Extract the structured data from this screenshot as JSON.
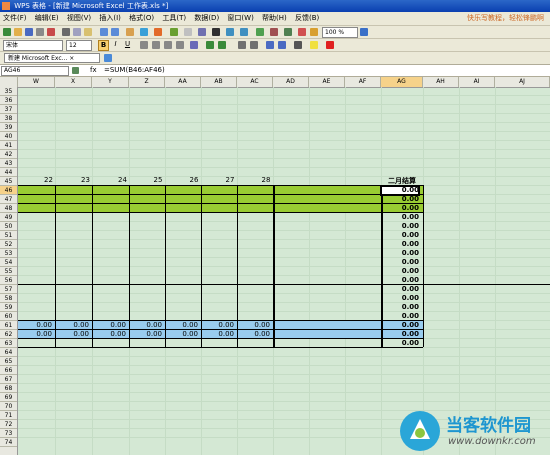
{
  "window": {
    "title": "WPS 表格 - [新建 Microsoft Excel 工作表.xls *]",
    "hint": "快乐写教程，轻松锋鹏啊"
  },
  "menu": {
    "items": [
      "文件(F)",
      "编辑(E)",
      "视图(V)",
      "插入(I)",
      "格式(O)",
      "工具(T)",
      "数据(D)",
      "窗口(W)",
      "帮助(H)",
      "反馈(B)"
    ],
    "hint": "快乐写教程，轻松锋鹏啊"
  },
  "toolbar": {
    "zoom": "100 %",
    "font_name": "宋体",
    "font_size": "12",
    "bold": "B",
    "italic": "I",
    "underline": "U"
  },
  "tabs": {
    "doc_tab": "新建 Microsoft Exc... ×"
  },
  "formula_bar": {
    "name_box": "AG46",
    "fx": "fx",
    "formula": "=SUM(B46:AF46)"
  },
  "sheet": {
    "columns": [
      "W",
      "X",
      "Y",
      "Z",
      "AA",
      "AB",
      "AC",
      "AD",
      "AE",
      "AF",
      "AG",
      "AH",
      "AI",
      "AJ"
    ],
    "rows": [
      "35",
      "36",
      "37",
      "38",
      "39",
      "40",
      "41",
      "42",
      "43",
      "44",
      "45",
      "46",
      "47",
      "48",
      "49",
      "50",
      "51",
      "52",
      "53",
      "54",
      "55",
      "56",
      "57",
      "58",
      "59",
      "60",
      "61",
      "62",
      "63",
      "64",
      "65",
      "66",
      "67",
      "68",
      "69",
      "70",
      "71",
      "72",
      "73",
      "74"
    ],
    "row45_days": [
      "22",
      "23",
      "24",
      "25",
      "26",
      "27",
      "28"
    ],
    "ag45_header": "二月结算",
    "ag_values": [
      "0.00",
      "0.00",
      "0.00",
      "0.00",
      "0.00",
      "0.00",
      "0.00",
      "0.00",
      "0.00",
      "0.00",
      "0.00",
      "0.00",
      "0.00",
      "0.00",
      "0.00",
      "0.00",
      "0.00",
      "0.00"
    ],
    "row61_values": [
      "0.00",
      "0.00",
      "0.00",
      "0.00",
      "0.00",
      "0.00",
      "0.00"
    ],
    "row62_values": [
      "0.00",
      "0.00",
      "0.00",
      "0.00",
      "0.00",
      "0.00",
      "0.00"
    ]
  },
  "watermark": {
    "brand": "当客软件园",
    "url": "www.downkr.com"
  },
  "colors": {
    "green_fill": "#99cc33",
    "blue_fill": "#99ccee",
    "sheet_bg": "#d4e8d4",
    "titlebar": "#0a3fb0"
  }
}
